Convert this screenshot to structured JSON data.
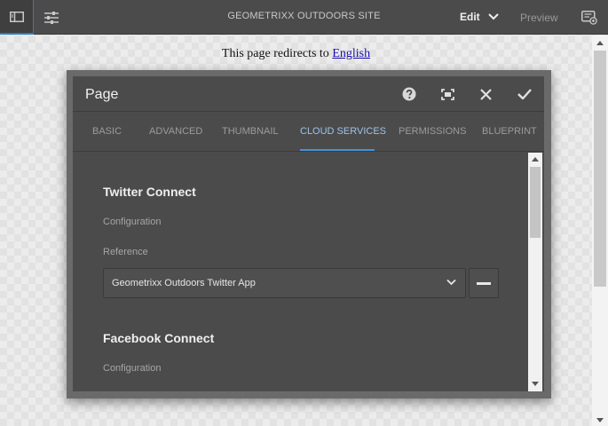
{
  "toolbar": {
    "site_title": "GEOMETRIXX OUTDOORS SITE",
    "mode_label": "Edit",
    "preview_label": "Preview",
    "icons": [
      "side-panel-icon",
      "page-properties-icon",
      "annotate-icon",
      "chevron-down-icon"
    ]
  },
  "page": {
    "redirect_text": "This page redirects to ",
    "redirect_link": "English"
  },
  "dialog": {
    "title": "Page",
    "header_icons": [
      "help-icon",
      "fullscreen-icon",
      "close-icon",
      "checkmark-icon"
    ],
    "tabs": [
      {
        "label": "BASIC",
        "active": false
      },
      {
        "label": "ADVANCED",
        "active": false
      },
      {
        "label": "THUMBNAIL",
        "active": false
      },
      {
        "label": "CLOUD SERVICES",
        "active": true
      },
      {
        "label": "PERMISSIONS",
        "active": false
      },
      {
        "label": "BLUEPRINT",
        "active": false
      }
    ],
    "sections": [
      {
        "title": "Twitter Connect",
        "configuration_label": "Configuration",
        "reference_label": "Reference",
        "selected_value": "Geometrixx Outdoors Twitter App"
      },
      {
        "title": "Facebook Connect",
        "configuration_label": "Configuration"
      }
    ]
  },
  "colors": {
    "toolbar_bg": "#4b4b4b",
    "dialog_bg": "#4b4b4b",
    "active_tab": "#9fc3e8",
    "accent": "#4a90d9"
  }
}
